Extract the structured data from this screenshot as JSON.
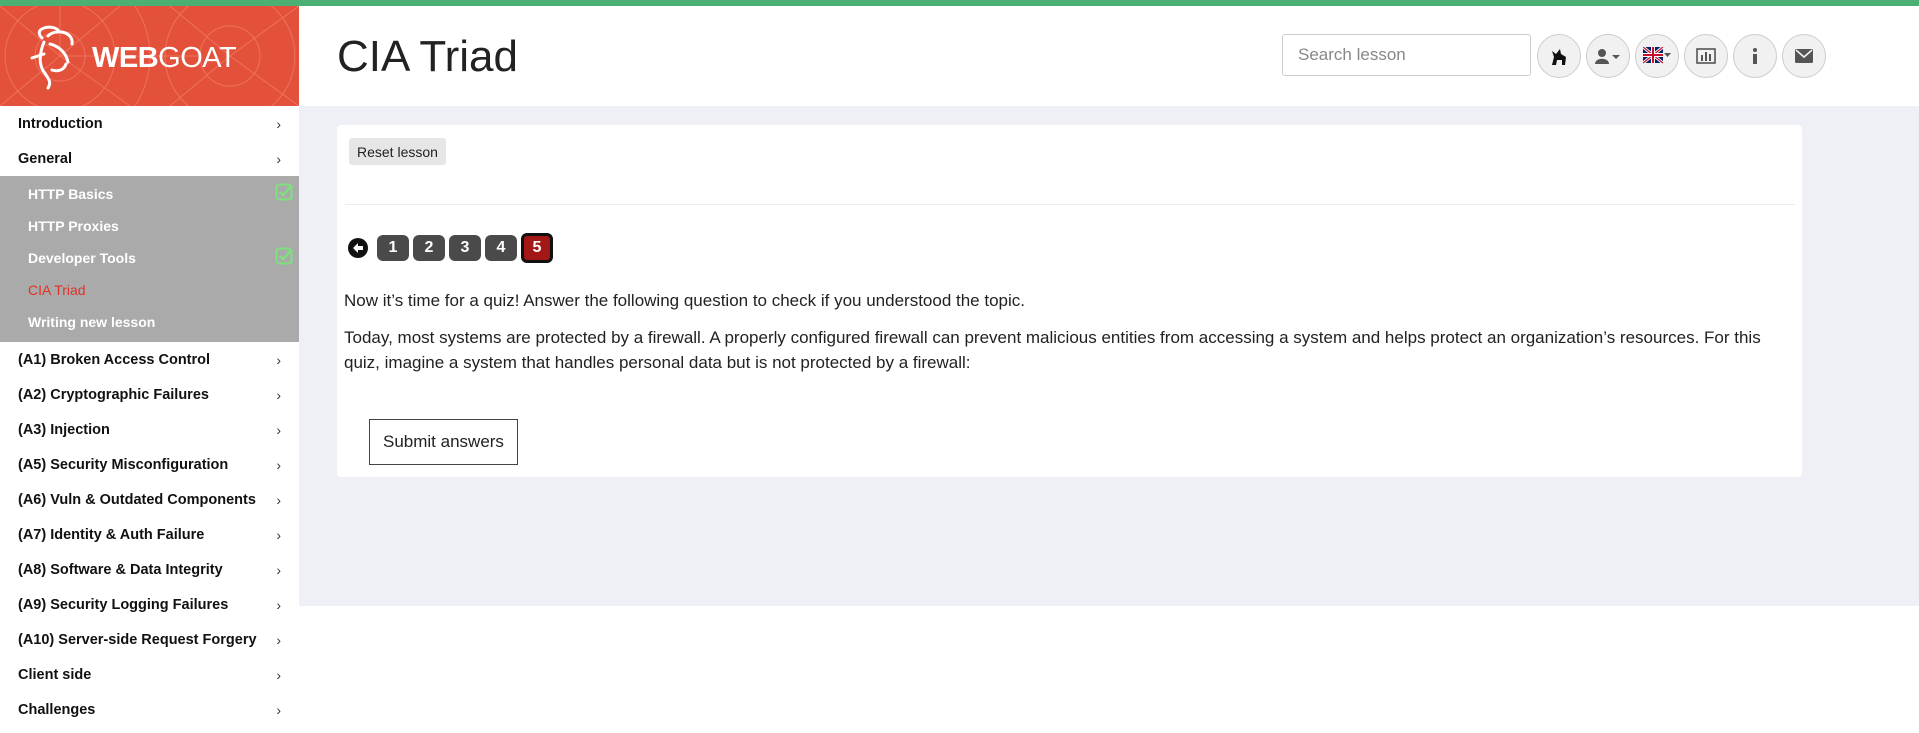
{
  "brand": {
    "bold": "WEB",
    "light": "GOAT"
  },
  "header": {
    "title": "CIA Triad",
    "search_placeholder": "Search lesson",
    "buttons": [
      "wolf-icon",
      "user-icon",
      "flag-icon",
      "chart-icon",
      "info-icon",
      "envelope-icon"
    ]
  },
  "sidebar": {
    "categories_top": [
      {
        "label": "Introduction"
      },
      {
        "label": "General"
      }
    ],
    "general_items": [
      {
        "label": "HTTP Basics",
        "completed": true
      },
      {
        "label": "HTTP Proxies",
        "completed": false
      },
      {
        "label": "Developer Tools",
        "completed": true
      },
      {
        "label": "CIA Triad",
        "active": true
      },
      {
        "label": "Writing new lesson",
        "completed": false
      }
    ],
    "categories_bottom": [
      {
        "label": "(A1) Broken Access Control"
      },
      {
        "label": "(A2) Cryptographic Failures"
      },
      {
        "label": "(A3) Injection"
      },
      {
        "label": "(A5) Security Misconfiguration"
      },
      {
        "label": "(A6) Vuln & Outdated Components"
      },
      {
        "label": "(A7) Identity & Auth Failure"
      },
      {
        "label": "(A8) Software & Data Integrity"
      },
      {
        "label": "(A9) Security Logging Failures"
      },
      {
        "label": "(A10) Server-side Request Forgery"
      },
      {
        "label": "Client side"
      },
      {
        "label": "Challenges"
      }
    ],
    "chevron": "›"
  },
  "lesson": {
    "reset_label": "Reset lesson",
    "pages": [
      "1",
      "2",
      "3",
      "4",
      "5"
    ],
    "current_page": "5",
    "intro": "Now it’s time for a quiz! Answer the following question to check if you understood the topic.",
    "body": "Today, most systems are protected by a firewall. A properly configured firewall can prevent malicious entities from accessing a system and helps protect an organization’s resources. For this quiz, imagine a system that handles personal data but is not protected by a firewall:",
    "submit_label": "Submit answers"
  },
  "colors": {
    "brand_red": "#e4513a",
    "top_stripe": "#4caf74",
    "active_item": "#e0322a",
    "current_page": "#a31717",
    "check_green": "#7ee07e"
  }
}
